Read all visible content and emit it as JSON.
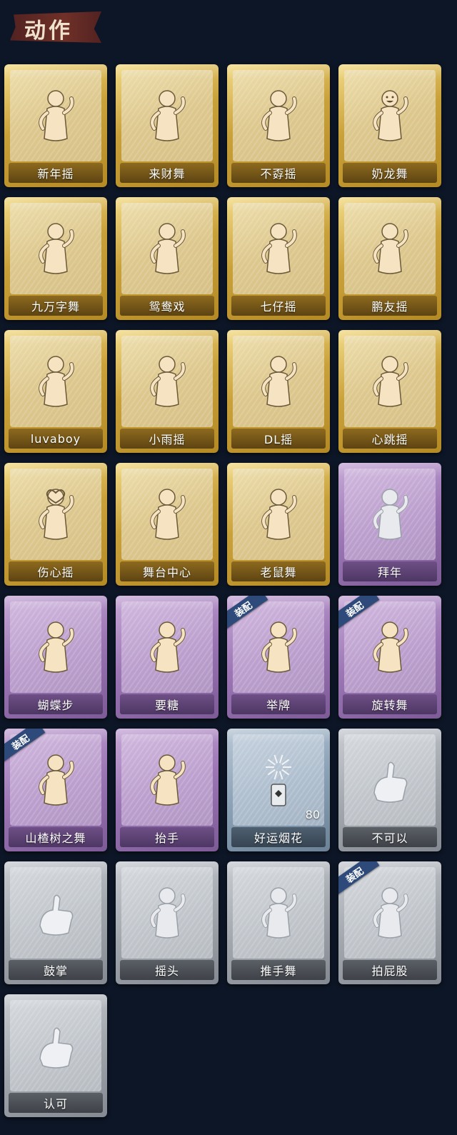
{
  "header": {
    "title": "动作"
  },
  "equipped_badge": "装配",
  "colors": {
    "gold": "#c9a13a",
    "purple": "#9b75b4",
    "blue": "#8aa0b5",
    "gray": "#a2a7ae",
    "badge": "#2d4a7a",
    "background": "#0d1626"
  },
  "actions": [
    {
      "label": "新年摇",
      "rarity": "gold",
      "equipped": false,
      "icon": "clapping-figure-icon"
    },
    {
      "label": "来财舞",
      "rarity": "gold",
      "equipped": false,
      "icon": "dancing-figure-icon"
    },
    {
      "label": "不孬摇",
      "rarity": "gold",
      "equipped": false,
      "icon": "dancing-figure-icon"
    },
    {
      "label": "奶龙舞",
      "rarity": "gold",
      "equipped": false,
      "icon": "smiley-figure-icon"
    },
    {
      "label": "九万字舞",
      "rarity": "gold",
      "equipped": false,
      "icon": "dancing-figure-icon"
    },
    {
      "label": "鸳鸯戏",
      "rarity": "gold",
      "equipped": false,
      "icon": "dancing-figure-icon"
    },
    {
      "label": "七仔摇",
      "rarity": "gold",
      "equipped": false,
      "icon": "dancing-figure-icon"
    },
    {
      "label": "鹏友摇",
      "rarity": "gold",
      "equipped": false,
      "icon": "dancing-figure-icon"
    },
    {
      "label": "luvaboy",
      "rarity": "gold",
      "equipped": false,
      "icon": "dancing-figure-icon"
    },
    {
      "label": "小雨摇",
      "rarity": "gold",
      "equipped": false,
      "icon": "dancing-figure-icon"
    },
    {
      "label": "DL摇",
      "rarity": "gold",
      "equipped": false,
      "icon": "dancing-figure-icon"
    },
    {
      "label": "心跳摇",
      "rarity": "gold",
      "equipped": false,
      "icon": "dancing-figure-icon"
    },
    {
      "label": "伤心摇",
      "rarity": "gold",
      "equipped": false,
      "icon": "heart-figure-icon"
    },
    {
      "label": "舞台中心",
      "rarity": "gold",
      "equipped": false,
      "icon": "dancing-figure-icon"
    },
    {
      "label": "老鼠舞",
      "rarity": "gold",
      "equipped": false,
      "icon": "dancing-figure-icon"
    },
    {
      "label": "拜年",
      "rarity": "purple",
      "equipped": false,
      "icon": "bowing-figure-icon"
    },
    {
      "label": "蝴蝶步",
      "rarity": "purple",
      "equipped": false,
      "icon": "dancing-figure-icon"
    },
    {
      "label": "要糖",
      "rarity": "purple",
      "equipped": false,
      "icon": "dancing-figure-icon"
    },
    {
      "label": "举牌",
      "rarity": "purple",
      "equipped": true,
      "icon": "sign-figure-icon"
    },
    {
      "label": "旋转舞",
      "rarity": "purple",
      "equipped": true,
      "icon": "spinning-figure-icon"
    },
    {
      "label": "山楂树之舞",
      "rarity": "purple",
      "equipped": true,
      "icon": "dancing-figure-icon"
    },
    {
      "label": "抬手",
      "rarity": "purple",
      "equipped": false,
      "icon": "dancing-figure-icon"
    },
    {
      "label": "好运烟花",
      "rarity": "blue",
      "equipped": false,
      "icon": "firework-icon",
      "count": "80"
    },
    {
      "label": "不可以",
      "rarity": "gray",
      "equipped": false,
      "icon": "finger-wag-icon"
    },
    {
      "label": "鼓掌",
      "rarity": "gray",
      "equipped": false,
      "icon": "clapping-hands-icon"
    },
    {
      "label": "摇头",
      "rarity": "gray",
      "equipped": false,
      "icon": "figure-icon"
    },
    {
      "label": "推手舞",
      "rarity": "gray",
      "equipped": false,
      "icon": "figure-icon"
    },
    {
      "label": "拍屁股",
      "rarity": "gray",
      "equipped": true,
      "icon": "figure-icon"
    },
    {
      "label": "认可",
      "rarity": "gray",
      "equipped": false,
      "icon": "thumbs-up-icon"
    }
  ]
}
